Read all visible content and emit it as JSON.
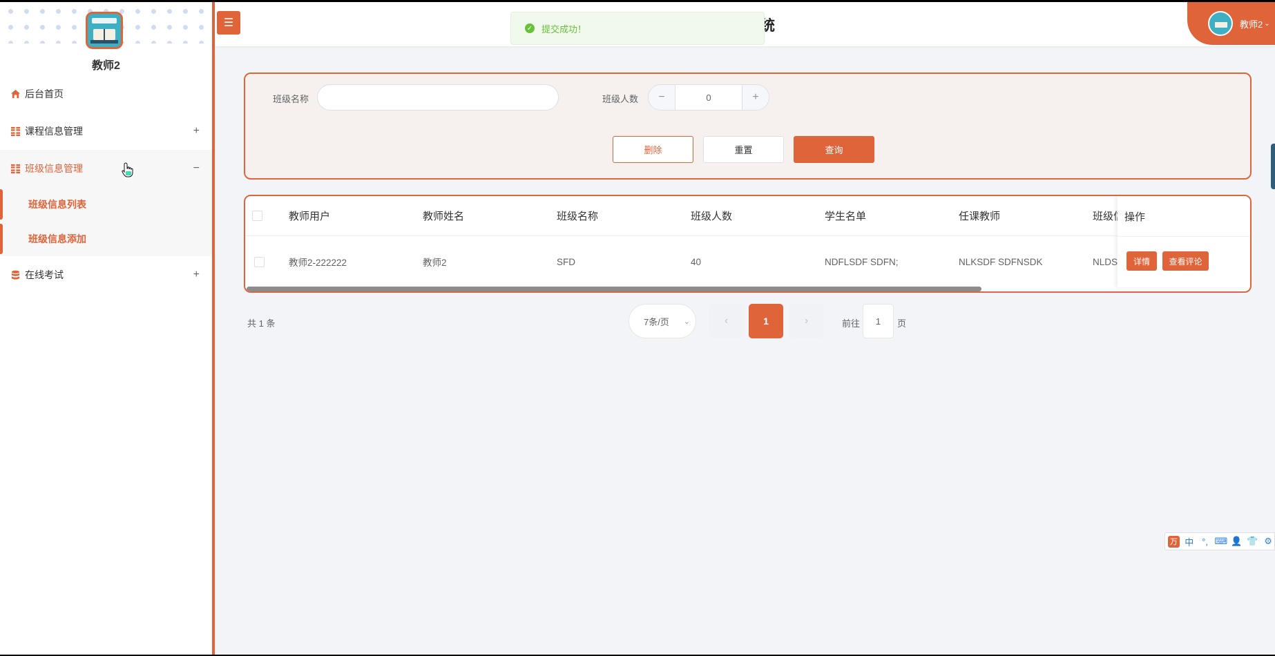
{
  "sidebar": {
    "username": "教师2",
    "menu": [
      {
        "label": "后台首页"
      },
      {
        "label": "课程信息管理",
        "toggle": "+"
      },
      {
        "label": "班级信息管理",
        "toggle": "−",
        "active": true,
        "children": [
          {
            "label": "班级信息列表"
          },
          {
            "label": "班级信息添加"
          }
        ]
      },
      {
        "label": "在线考试",
        "toggle": "+"
      }
    ]
  },
  "header": {
    "title_fragment": "统",
    "toast": "提交成功！",
    "user_label": "教师2"
  },
  "search": {
    "class_name_label": "班级名称",
    "class_name_value": "",
    "class_size_label": "班级人数",
    "class_size_value": "0",
    "delete_label": "删除",
    "reset_label": "重置",
    "query_label": "查询"
  },
  "table": {
    "columns": [
      "教师用户",
      "教师姓名",
      "班级名称",
      "班级人数",
      "学生名单",
      "任课教师",
      "班级信"
    ],
    "rows": [
      [
        "教师2-222222",
        "教师2",
        "SFD",
        "40",
        "NDFLSDF SDFN;",
        "NLKSDF SDFNSDK",
        "NLDSF"
      ]
    ],
    "op_header": "操作",
    "detail_label": "详情",
    "comments_label": "查看评论"
  },
  "pagination": {
    "total": "共 1 条",
    "page_size": "7条/页",
    "current_page": "1",
    "goto_prefix": "前往",
    "goto_value": "1",
    "goto_suffix": "页"
  },
  "ime": {
    "logo": "万",
    "items": [
      "中",
      "°,",
      "⌨",
      "👤",
      "👕",
      "⚙"
    ]
  },
  "colors": {
    "accent": "#e0643a",
    "success": "#67c23a",
    "page_bg": "#f2f4f7"
  }
}
